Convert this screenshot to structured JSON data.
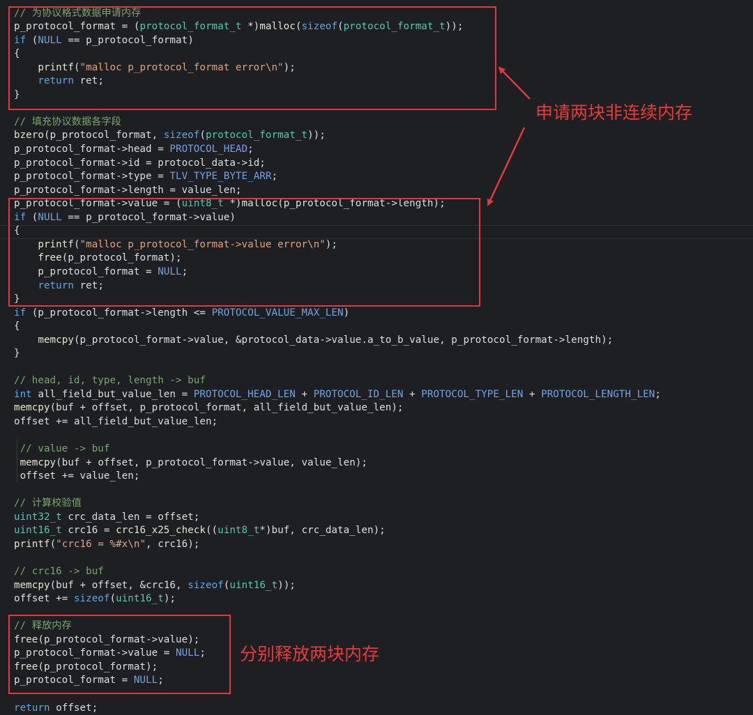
{
  "colors": {
    "background": "#1e1f22",
    "annotation": "#e0393e",
    "comment": "#78a86a",
    "keyword": "#59a9e6",
    "type": "#4ec9b0",
    "string": "#e2a47c",
    "macro": "#6fa5e8",
    "identifier": "#dcdfe4"
  },
  "code": {
    "lines": [
      [
        [
          "cmt",
          "// 为协议格式数据申请内存"
        ]
      ],
      [
        [
          "id",
          "p_protocol_format"
        ],
        [
          "p",
          " = ("
        ],
        [
          "type",
          "protocol_format_t"
        ],
        [
          "p",
          " *)"
        ],
        [
          "fn",
          "malloc"
        ],
        [
          "p",
          "("
        ],
        [
          "kw",
          "sizeof"
        ],
        [
          "p",
          "("
        ],
        [
          "type",
          "protocol_format_t"
        ],
        [
          "p",
          "));"
        ]
      ],
      [
        [
          "kw",
          "if"
        ],
        [
          "p",
          " ("
        ],
        [
          "mac",
          "NULL"
        ],
        [
          "p",
          " == "
        ],
        [
          "id",
          "p_protocol_format"
        ],
        [
          "p",
          ")"
        ]
      ],
      [
        [
          "p",
          "{"
        ]
      ],
      [
        [
          "p",
          "    "
        ],
        [
          "fn",
          "printf"
        ],
        [
          "p",
          "("
        ],
        [
          "str",
          "\"malloc p_protocol_format error\\n\""
        ],
        [
          "p",
          ");"
        ]
      ],
      [
        [
          "p",
          "    "
        ],
        [
          "kw",
          "return"
        ],
        [
          "p",
          " "
        ],
        [
          "id",
          "ret"
        ],
        [
          "p",
          ";"
        ]
      ],
      [
        [
          "p",
          "}"
        ]
      ],
      [
        [
          "p",
          ""
        ]
      ],
      [
        [
          "cmt",
          "// 填充协议数据各字段"
        ]
      ],
      [
        [
          "fn",
          "bzero"
        ],
        [
          "p",
          "("
        ],
        [
          "id",
          "p_protocol_format"
        ],
        [
          "p",
          ", "
        ],
        [
          "kw",
          "sizeof"
        ],
        [
          "p",
          "("
        ],
        [
          "type",
          "protocol_format_t"
        ],
        [
          "p",
          "));"
        ]
      ],
      [
        [
          "id",
          "p_protocol_format"
        ],
        [
          "p",
          "->"
        ],
        [
          "id",
          "head"
        ],
        [
          "p",
          " = "
        ],
        [
          "mac",
          "PROTOCOL_HEAD"
        ],
        [
          "p",
          ";"
        ]
      ],
      [
        [
          "id",
          "p_protocol_format"
        ],
        [
          "p",
          "->"
        ],
        [
          "id",
          "id"
        ],
        [
          "p",
          " = "
        ],
        [
          "id",
          "protocol_data"
        ],
        [
          "p",
          "->"
        ],
        [
          "id",
          "id"
        ],
        [
          "p",
          ";"
        ]
      ],
      [
        [
          "id",
          "p_protocol_format"
        ],
        [
          "p",
          "->"
        ],
        [
          "id",
          "type"
        ],
        [
          "p",
          " = "
        ],
        [
          "mac",
          "TLV_TYPE_BYTE_ARR"
        ],
        [
          "p",
          ";"
        ]
      ],
      [
        [
          "id",
          "p_protocol_format"
        ],
        [
          "p",
          "->"
        ],
        [
          "id",
          "length"
        ],
        [
          "p",
          " = "
        ],
        [
          "id",
          "value_len"
        ],
        [
          "p",
          ";"
        ]
      ],
      [
        [
          "id",
          "p_protocol_format"
        ],
        [
          "p",
          "->"
        ],
        [
          "id",
          "value"
        ],
        [
          "p",
          " = ("
        ],
        [
          "type",
          "uint8_t"
        ],
        [
          "p",
          " *)"
        ],
        [
          "fn",
          "malloc"
        ],
        [
          "p",
          "("
        ],
        [
          "id",
          "p_protocol_format"
        ],
        [
          "p",
          "->"
        ],
        [
          "id",
          "length"
        ],
        [
          "p",
          ");"
        ]
      ],
      [
        [
          "kw",
          "if"
        ],
        [
          "p",
          " ("
        ],
        [
          "mac",
          "NULL"
        ],
        [
          "p",
          " == "
        ],
        [
          "id",
          "p_protocol_format"
        ],
        [
          "p",
          "->"
        ],
        [
          "id",
          "value"
        ],
        [
          "p",
          ")"
        ]
      ],
      [
        [
          "p",
          "{"
        ]
      ],
      [
        [
          "p",
          "    "
        ],
        [
          "fn",
          "printf"
        ],
        [
          "p",
          "("
        ],
        [
          "str",
          "\"malloc p_protocol_format->value error\\n\""
        ],
        [
          "p",
          ");"
        ]
      ],
      [
        [
          "p",
          "    "
        ],
        [
          "fn",
          "free"
        ],
        [
          "p",
          "("
        ],
        [
          "id",
          "p_protocol_format"
        ],
        [
          "p",
          ");"
        ]
      ],
      [
        [
          "p",
          "    "
        ],
        [
          "id",
          "p_protocol_format"
        ],
        [
          "p",
          " = "
        ],
        [
          "mac",
          "NULL"
        ],
        [
          "p",
          ";"
        ]
      ],
      [
        [
          "p",
          "    "
        ],
        [
          "kw",
          "return"
        ],
        [
          "p",
          " "
        ],
        [
          "id",
          "ret"
        ],
        [
          "p",
          ";"
        ]
      ],
      [
        [
          "p",
          "}"
        ]
      ],
      [
        [
          "kw",
          "if"
        ],
        [
          "p",
          " ("
        ],
        [
          "id",
          "p_protocol_format"
        ],
        [
          "p",
          "->"
        ],
        [
          "id",
          "length"
        ],
        [
          "p",
          " <= "
        ],
        [
          "mac",
          "PROTOCOL_VALUE_MAX_LEN"
        ],
        [
          "p",
          ")"
        ]
      ],
      [
        [
          "p",
          "{"
        ]
      ],
      [
        [
          "p",
          "    "
        ],
        [
          "fn",
          "memcpy"
        ],
        [
          "p",
          "("
        ],
        [
          "id",
          "p_protocol_format"
        ],
        [
          "p",
          "->"
        ],
        [
          "id",
          "value"
        ],
        [
          "p",
          ", &"
        ],
        [
          "id",
          "protocol_data"
        ],
        [
          "p",
          "->"
        ],
        [
          "id",
          "value"
        ],
        [
          "p",
          "."
        ],
        [
          "id",
          "a_to_b_value"
        ],
        [
          "p",
          ", "
        ],
        [
          "id",
          "p_protocol_format"
        ],
        [
          "p",
          "->"
        ],
        [
          "id",
          "length"
        ],
        [
          "p",
          ");"
        ]
      ],
      [
        [
          "p",
          "}"
        ]
      ],
      [
        [
          "p",
          ""
        ]
      ],
      [
        [
          "cmt",
          "// head, id, type, length -> buf"
        ]
      ],
      [
        [
          "kw",
          "int"
        ],
        [
          "p",
          " "
        ],
        [
          "id",
          "all_field_but_value_len"
        ],
        [
          "p",
          " = "
        ],
        [
          "mac",
          "PROTOCOL_HEAD_LEN"
        ],
        [
          "p",
          " + "
        ],
        [
          "mac",
          "PROTOCOL_ID_LEN"
        ],
        [
          "p",
          " + "
        ],
        [
          "mac",
          "PROTOCOL_TYPE_LEN"
        ],
        [
          "p",
          " + "
        ],
        [
          "mac",
          "PROTOCOL_LENGTH_LEN"
        ],
        [
          "p",
          ";"
        ]
      ],
      [
        [
          "fn",
          "memcpy"
        ],
        [
          "p",
          "("
        ],
        [
          "id",
          "buf"
        ],
        [
          "p",
          " + "
        ],
        [
          "id",
          "offset"
        ],
        [
          "p",
          ", "
        ],
        [
          "id",
          "p_protocol_format"
        ],
        [
          "p",
          ", "
        ],
        [
          "id",
          "all_field_but_value_len"
        ],
        [
          "p",
          ");"
        ]
      ],
      [
        [
          "id",
          "offset"
        ],
        [
          "p",
          " += "
        ],
        [
          "id",
          "all_field_but_value_len"
        ],
        [
          "p",
          ";"
        ]
      ],
      [
        [
          "p",
          ""
        ]
      ],
      [
        [
          "p",
          " "
        ],
        [
          "cmt",
          "// value -> buf"
        ]
      ],
      [
        [
          "p",
          " "
        ],
        [
          "fn",
          "memcpy"
        ],
        [
          "p",
          "("
        ],
        [
          "id",
          "buf"
        ],
        [
          "p",
          " + "
        ],
        [
          "id",
          "offset"
        ],
        [
          "p",
          ", "
        ],
        [
          "id",
          "p_protocol_format"
        ],
        [
          "p",
          "->"
        ],
        [
          "id",
          "value"
        ],
        [
          "p",
          ", "
        ],
        [
          "id",
          "value_len"
        ],
        [
          "p",
          ");"
        ]
      ],
      [
        [
          "p",
          " "
        ],
        [
          "id",
          "offset"
        ],
        [
          "p",
          " += "
        ],
        [
          "id",
          "value_len"
        ],
        [
          "p",
          ";"
        ]
      ],
      [
        [
          "p",
          ""
        ]
      ],
      [
        [
          "cmt",
          "// 计算校验值"
        ]
      ],
      [
        [
          "type",
          "uint32_t"
        ],
        [
          "p",
          " "
        ],
        [
          "id",
          "crc_data_len"
        ],
        [
          "p",
          " = "
        ],
        [
          "id",
          "offset"
        ],
        [
          "p",
          ";"
        ]
      ],
      [
        [
          "type",
          "uint16_t"
        ],
        [
          "p",
          " "
        ],
        [
          "id",
          "crc16"
        ],
        [
          "p",
          " = "
        ],
        [
          "fn",
          "crc16_x25_check"
        ],
        [
          "p",
          "(("
        ],
        [
          "type",
          "uint8_t"
        ],
        [
          "p",
          "*)"
        ],
        [
          "id",
          "buf"
        ],
        [
          "p",
          ", "
        ],
        [
          "id",
          "crc_data_len"
        ],
        [
          "p",
          ");"
        ]
      ],
      [
        [
          "fn",
          "printf"
        ],
        [
          "p",
          "("
        ],
        [
          "str",
          "\"crc16 = %#x\\n\""
        ],
        [
          "p",
          ", "
        ],
        [
          "id",
          "crc16"
        ],
        [
          "p",
          ");"
        ]
      ],
      [
        [
          "p",
          ""
        ]
      ],
      [
        [
          "cmt",
          "// crc16 -> buf"
        ]
      ],
      [
        [
          "fn",
          "memcpy"
        ],
        [
          "p",
          "("
        ],
        [
          "id",
          "buf"
        ],
        [
          "p",
          " + "
        ],
        [
          "id",
          "offset"
        ],
        [
          "p",
          ", &"
        ],
        [
          "id",
          "crc16"
        ],
        [
          "p",
          ", "
        ],
        [
          "kw",
          "sizeof"
        ],
        [
          "p",
          "("
        ],
        [
          "type",
          "uint16_t"
        ],
        [
          "p",
          "));"
        ]
      ],
      [
        [
          "id",
          "offset"
        ],
        [
          "p",
          " += "
        ],
        [
          "kw",
          "sizeof"
        ],
        [
          "p",
          "("
        ],
        [
          "type",
          "uint16_t"
        ],
        [
          "p",
          ");"
        ]
      ],
      [
        [
          "p",
          ""
        ]
      ],
      [
        [
          "cmt",
          "// 释放内存"
        ]
      ],
      [
        [
          "fn",
          "free"
        ],
        [
          "p",
          "("
        ],
        [
          "id",
          "p_protocol_format"
        ],
        [
          "p",
          "->"
        ],
        [
          "id",
          "value"
        ],
        [
          "p",
          ");"
        ]
      ],
      [
        [
          "id",
          "p_protocol_format"
        ],
        [
          "p",
          "->"
        ],
        [
          "id",
          "value"
        ],
        [
          "p",
          " = "
        ],
        [
          "mac",
          "NULL"
        ],
        [
          "p",
          ";"
        ]
      ],
      [
        [
          "fn",
          "free"
        ],
        [
          "p",
          "("
        ],
        [
          "id",
          "p_protocol_format"
        ],
        [
          "p",
          ");"
        ]
      ],
      [
        [
          "id",
          "p_protocol_format"
        ],
        [
          "p",
          " = "
        ],
        [
          "mac",
          "NULL"
        ],
        [
          "p",
          ";"
        ]
      ],
      [
        [
          "p",
          ""
        ]
      ],
      [
        [
          "kw",
          "return"
        ],
        [
          "p",
          " "
        ],
        [
          "id",
          "offset"
        ],
        [
          "p",
          ";"
        ]
      ]
    ]
  },
  "annotations": {
    "note_alloc": "申请两块非连续内存",
    "note_free": "分别释放两块内存"
  }
}
